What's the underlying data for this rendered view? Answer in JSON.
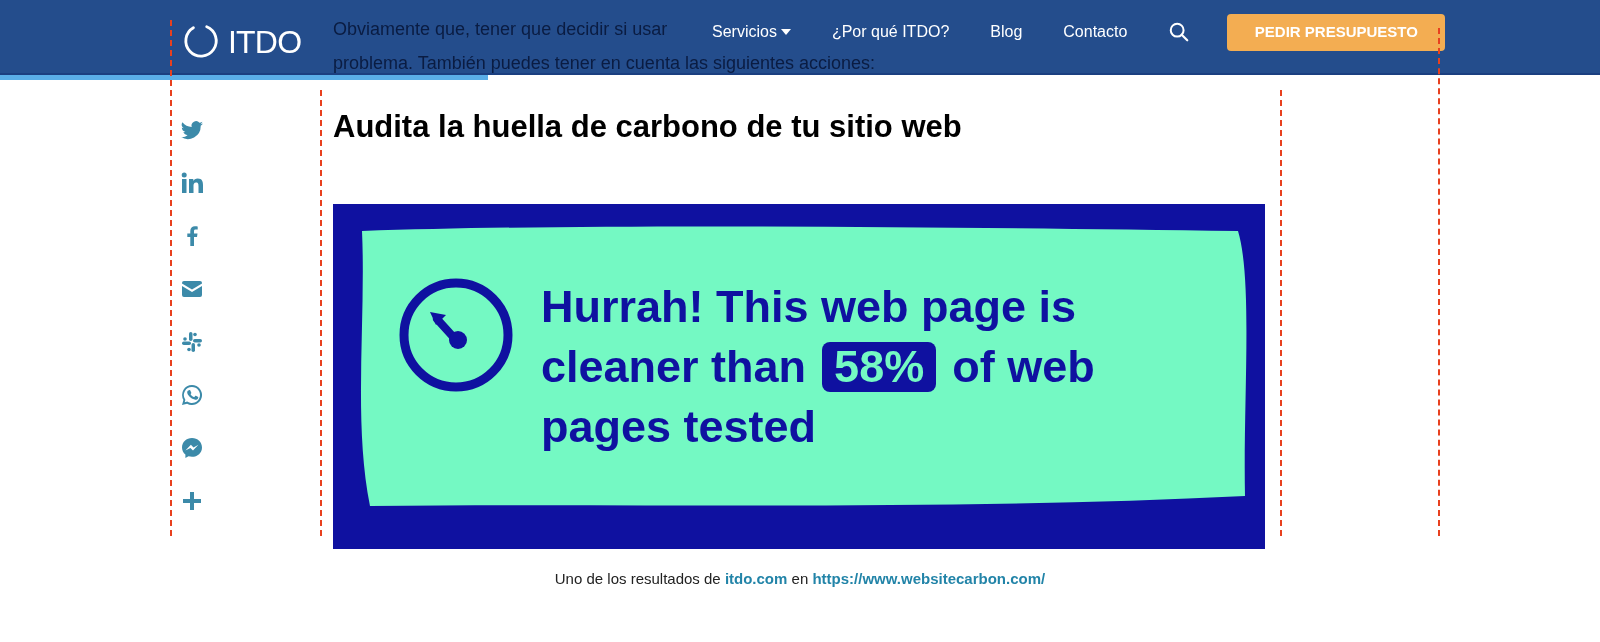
{
  "header": {
    "logo": "ITDO",
    "nav": [
      {
        "label": "Servicios",
        "has_dropdown": true
      },
      {
        "label": "¿Por qué ITDO?",
        "has_dropdown": false
      },
      {
        "label": "Blog",
        "has_dropdown": false
      },
      {
        "label": "Contacto",
        "has_dropdown": false
      }
    ],
    "cta": "PEDIR PRESUPUESTO",
    "reading_progress": {
      "level": 0.305
    }
  },
  "background_paragraph": [
    "Obviamente que, tener que decidir si usar",
    "problema. También puedes tener en cuenta las siguientes acciones:"
  ],
  "share_icons": [
    {
      "kind": "twitter"
    },
    {
      "kind": "linkedin"
    },
    {
      "kind": "facebook"
    },
    {
      "kind": "email"
    },
    {
      "kind": "slack"
    },
    {
      "kind": "whatsapp"
    },
    {
      "kind": "messenger"
    },
    {
      "kind": "more"
    }
  ],
  "heading": "Audita la huella de carbono de tu sitio web",
  "banner": {
    "line_1": "Hurrah! This web page is",
    "before_highlight": "cleaner than",
    "highlight": "58%",
    "after_highlight": "of web",
    "line_3": "pages tested"
  },
  "caption": {
    "text": "Uno de los resultados de",
    "link1": "itdo.com",
    "middle": "en",
    "link2": "https://www.websitecarbon.com/"
  }
}
